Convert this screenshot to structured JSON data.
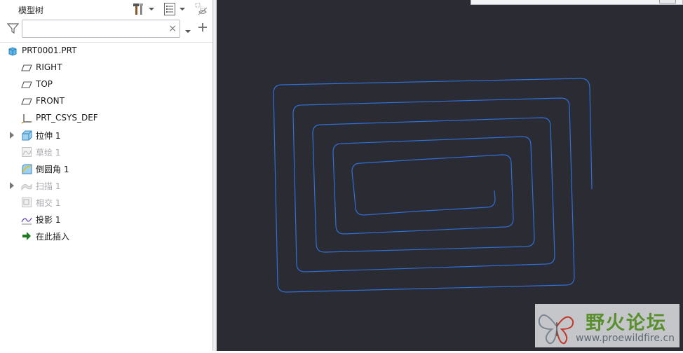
{
  "model_tree": {
    "title": "模型树",
    "filter": {
      "value": "",
      "placeholder": ""
    },
    "items": [
      {
        "label": "PRT0001.PRT",
        "icon": "part-icon",
        "expandable": false,
        "dimmed": false
      },
      {
        "label": "RIGHT",
        "icon": "datum-plane-icon",
        "expandable": false,
        "dimmed": false
      },
      {
        "label": "TOP",
        "icon": "datum-plane-icon",
        "expandable": false,
        "dimmed": false
      },
      {
        "label": "FRONT",
        "icon": "datum-plane-icon",
        "expandable": false,
        "dimmed": false
      },
      {
        "label": "PRT_CSYS_DEF",
        "icon": "csys-icon",
        "expandable": false,
        "dimmed": false
      },
      {
        "label": "拉伸 1",
        "icon": "extrude-icon",
        "expandable": true,
        "dimmed": false
      },
      {
        "label": "草绘 1",
        "icon": "sketch-icon",
        "expandable": false,
        "dimmed": true
      },
      {
        "label": "倒圆角 1",
        "icon": "round-icon",
        "expandable": false,
        "dimmed": false
      },
      {
        "label": "扫描 1",
        "icon": "sweep-icon",
        "expandable": true,
        "dimmed": true
      },
      {
        "label": "相交 1",
        "icon": "intersect-icon",
        "expandable": false,
        "dimmed": true
      },
      {
        "label": "投影 1",
        "icon": "projection-icon",
        "expandable": false,
        "dimmed": false
      },
      {
        "label": "在此插入",
        "icon": "insert-here-arrow-icon",
        "expandable": false,
        "dimmed": false
      }
    ]
  },
  "viewport": {
    "background": "#2b2b33",
    "curve_color": "#2f6fd6"
  },
  "watermark": {
    "text": "野火论坛",
    "url": "www.proewildfire.cn"
  }
}
